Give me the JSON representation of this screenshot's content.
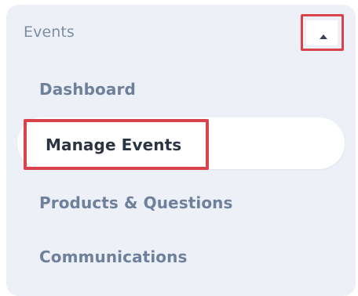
{
  "menu": {
    "section_title": "Events",
    "collapse_icon": "caret-up-icon",
    "items": [
      {
        "label": "Dashboard",
        "active": false
      },
      {
        "label": "Manage Events",
        "active": true
      },
      {
        "label": "Products & Questions",
        "active": false
      },
      {
        "label": "Communications",
        "active": false
      }
    ]
  },
  "colors": {
    "panel_bg": "#edf1f7",
    "highlight": "#d9434c",
    "active_text": "#2b3442",
    "inactive_text": "#6f809c",
    "header_text": "#7d8da6"
  }
}
